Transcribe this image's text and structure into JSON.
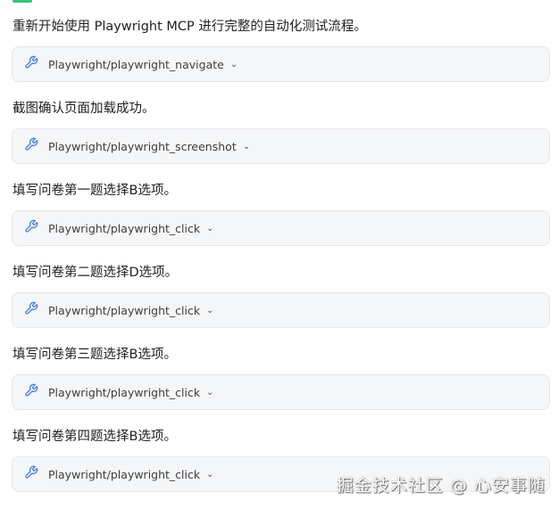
{
  "steps": [
    {
      "message": "重新开始使用 Playwright MCP 进行完整的自动化测试流程。",
      "tool": "Playwright/playwright_navigate"
    },
    {
      "message": "截图确认页面加载成功。",
      "tool": "Playwright/playwright_screenshot"
    },
    {
      "message": "填写问卷第一题选择B选项。",
      "tool": "Playwright/playwright_click"
    },
    {
      "message": "填写问卷第二题选择D选项。",
      "tool": "Playwright/playwright_click"
    },
    {
      "message": "填写问卷第三题选择B选项。",
      "tool": "Playwright/playwright_click"
    },
    {
      "message": "填写问卷第四题选择B选项。",
      "tool": "Playwright/playwright_click"
    }
  ],
  "watermark": "掘金技术社区 @ 心安事随",
  "colors": {
    "icon": "#4a7fd6",
    "box_bg": "#f5f6f8"
  }
}
